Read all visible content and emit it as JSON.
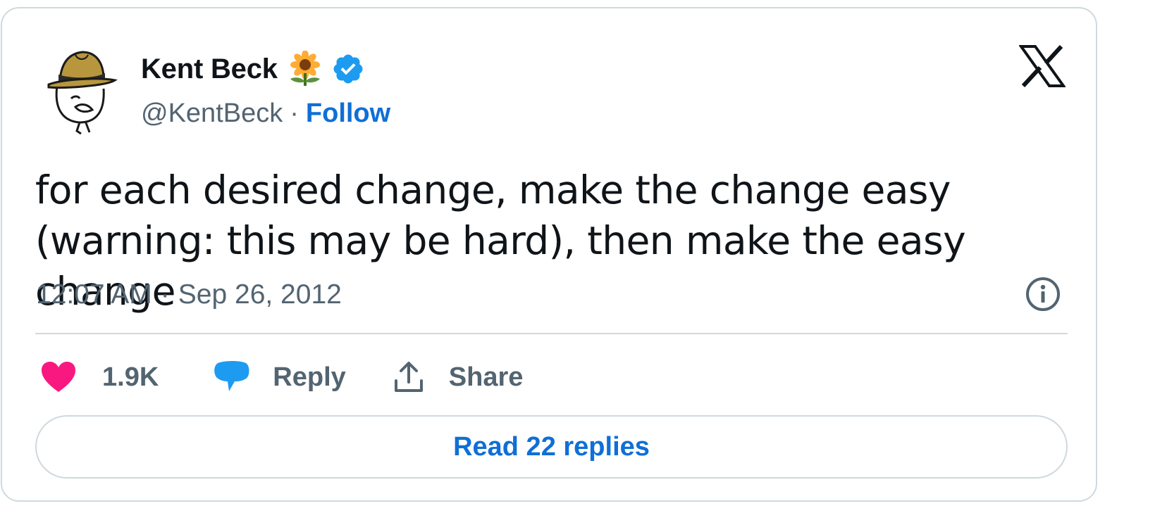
{
  "author": {
    "name": "Kent Beck",
    "handle": "@KentBeck",
    "follow_label": "Follow",
    "name_emoji": "sunflower-icon",
    "verified": "verified-badge-icon"
  },
  "tweet": {
    "text": "for each desired change, make the change easy (warning: this may be hard), then make the easy change",
    "time": "12:07 AM",
    "date": "Sep 26, 2012",
    "separator": "·"
  },
  "actions": {
    "likes_count": "1.9K",
    "reply_label": "Reply",
    "share_label": "Share"
  },
  "footer": {
    "read_replies_label": "Read 22 replies"
  },
  "colors": {
    "link_blue": "#0f6fd6",
    "verified_blue": "#1d9bf0",
    "like_pink": "#f91880",
    "muted_text": "#536471",
    "border": "#cfd9de"
  },
  "icons": [
    "x-logo-icon",
    "info-icon",
    "heart-icon",
    "reply-bubble-icon",
    "share-icon"
  ]
}
